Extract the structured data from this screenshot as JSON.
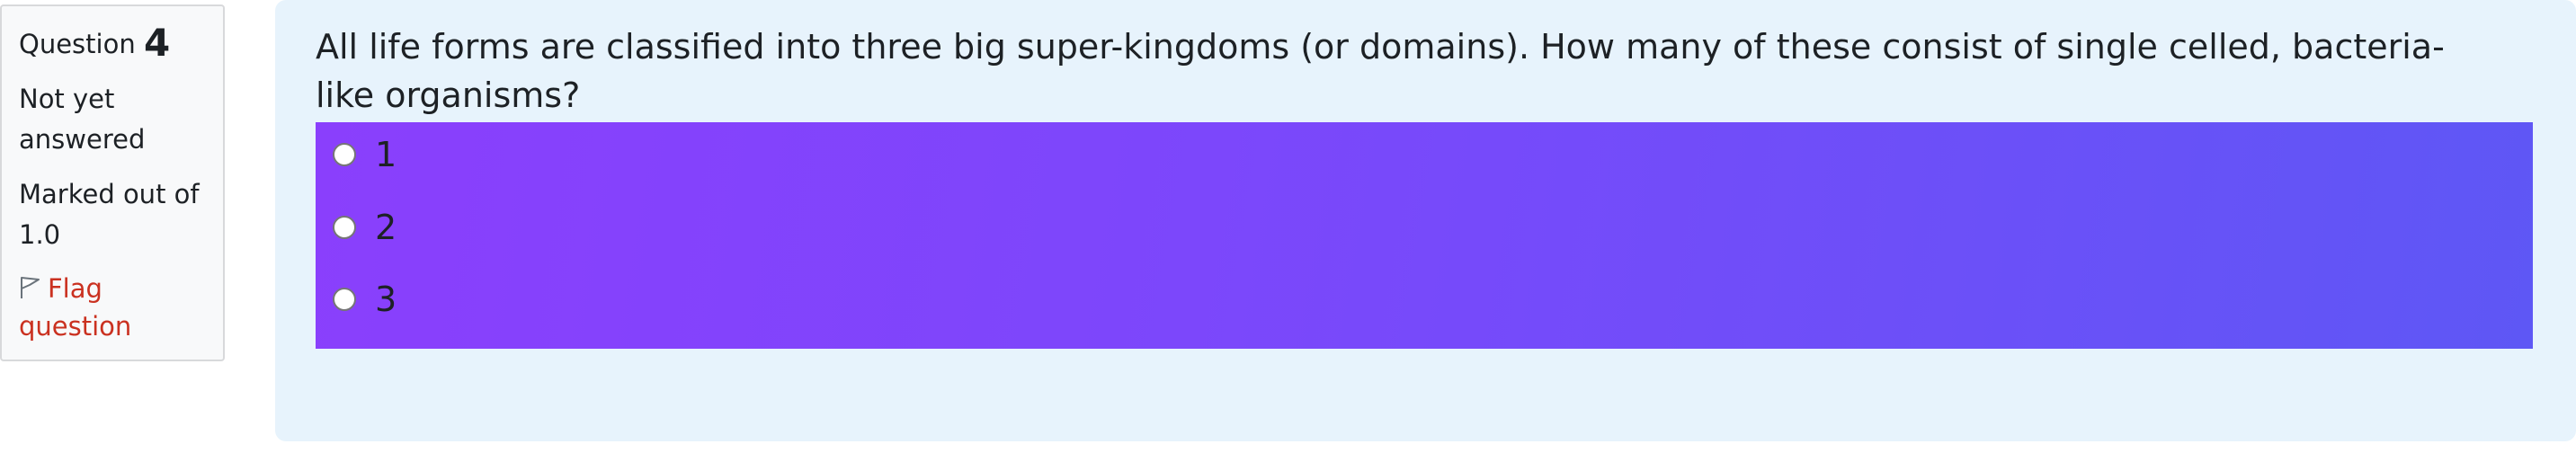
{
  "info": {
    "question_label": "Question",
    "question_number": "4",
    "state": "Not yet answered",
    "grade": "Marked out of 1.0",
    "flag_label": "Flag question"
  },
  "question": {
    "text": "All life forms are classified into three big super-kingdoms (or domains). How many of these consist of single celled, bacteria-like organisms?"
  },
  "answers": [
    {
      "label": "1",
      "selected": false
    },
    {
      "label": "2",
      "selected": false
    },
    {
      "label": "3",
      "selected": false
    }
  ],
  "colors": {
    "flag_text": "#ca3120",
    "card_background": "#e7f3fc",
    "answer_block_gradient": [
      "#8a3ffc",
      "#5e57f5"
    ]
  }
}
